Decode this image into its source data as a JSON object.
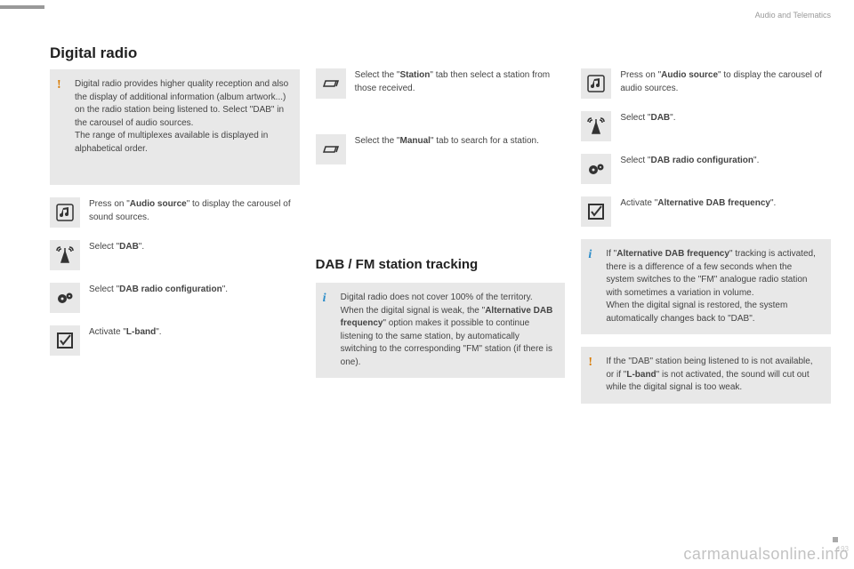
{
  "breadcrumb": "Audio and Telematics",
  "title": "Digital radio",
  "intro_note": "Digital radio provides higher quality reception and also the display of additional information (album artwork...) on the radio station being listened to. Select \"DAB\" in the carousel of audio sources.\nThe range of multiplexes available is displayed in alphabetical order.",
  "col1": {
    "step1_a": "Press on \"",
    "step1_b": "Audio source",
    "step1_c": "\" to display the carousel of sound sources.",
    "step2_a": "Select \"",
    "step2_b": "DAB",
    "step2_c": "\".",
    "step3_a": "Select \"",
    "step3_b": "DAB radio configuration",
    "step3_c": "\".",
    "step4_a": "Activate \"",
    "step4_b": "L-band",
    "step4_c": "\"."
  },
  "col2": {
    "step1_a": "Select the \"",
    "step1_b": "Station",
    "step1_c": "\" tab then select a station from those received.",
    "step2_a": "Select the \"",
    "step2_b": "Manual",
    "step2_c": "\" tab to search for a station.",
    "heading": "DAB / FM station tracking",
    "info_a": "Digital radio does not cover 100% of the territory.\nWhen the digital signal is weak, the \"",
    "info_b": "Alternative DAB frequency",
    "info_c": "\" option makes it possible to continue listening to the same station, by automatically switching to the corresponding \"FM\" station (if there is one)."
  },
  "col3": {
    "step1_a": "Press on \"",
    "step1_b": "Audio source",
    "step1_c": "\" to display the carousel of audio sources.",
    "step2_a": "Select \"",
    "step2_b": "DAB",
    "step2_c": "\".",
    "step3_a": "Select \"",
    "step3_b": "DAB radio configuration",
    "step3_c": "\".",
    "step4_a": "Activate \"",
    "step4_b": "Alternative DAB frequency",
    "step4_c": "\".",
    "info_a": "If \"",
    "info_b": "Alternative DAB frequency",
    "info_c": "\" tracking is activated, there is a difference of a few seconds when the system switches to the \"FM\" analogue radio station with sometimes a variation in volume.\nWhen the digital signal is restored, the system automatically changes back to \"DAB\".",
    "warn_a": "If the \"DAB\" station being listened to is not available, or if \"",
    "warn_b": "L-band",
    "warn_c": "\" is not activated, the sound will cut out while the digital signal is too weak."
  },
  "watermark": "carmanualsonline.info",
  "pagenum": "193"
}
